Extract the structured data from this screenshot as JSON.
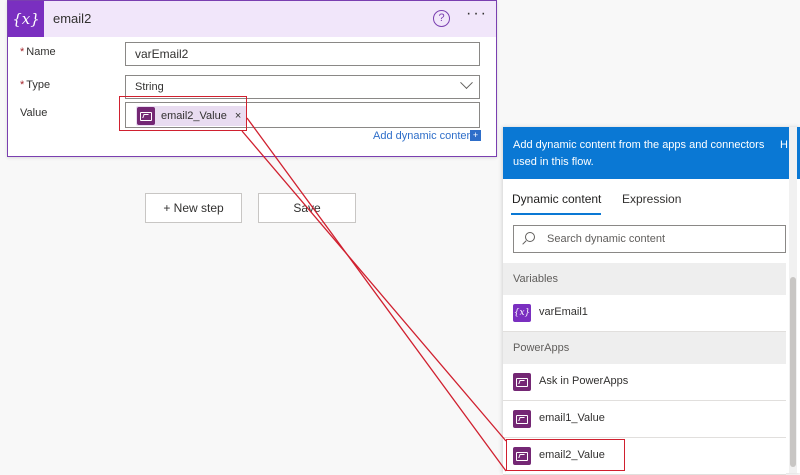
{
  "card": {
    "title": "email2",
    "var_icon": "{x}",
    "help_icon": "?",
    "more_icon": "···",
    "name_label": "Name",
    "name_value": "varEmail2",
    "type_label": "Type",
    "type_value": "String",
    "value_label": "Value",
    "required_mark": "*",
    "token_label": "email2_Value",
    "token_remove": "×",
    "add_dynamic_label": "Add dynamic content",
    "add_dynamic_icon": "+"
  },
  "actions": {
    "new_step": "+ New step",
    "save": "Save"
  },
  "panel": {
    "header_text": "Add dynamic content from the apps and connectors used in this flow.",
    "header_hide": "H",
    "tabs": [
      "Dynamic content",
      "Expression"
    ],
    "search_placeholder": "Search dynamic content",
    "sections": [
      {
        "title": "Variables",
        "items": [
          {
            "label": "varEmail1",
            "icon": "variable-icon"
          }
        ]
      },
      {
        "title": "PowerApps",
        "items": [
          {
            "label": "Ask in PowerApps",
            "icon": "powerapps-icon"
          },
          {
            "label": "email1_Value",
            "icon": "powerapps-icon"
          },
          {
            "label": "email2_Value",
            "icon": "powerapps-icon"
          }
        ]
      }
    ],
    "var_glyph": "{x}"
  },
  "colors": {
    "brand_purple": "#7a2fc0",
    "powerapps": "#742774",
    "accent_blue": "#0a78d4",
    "highlight_red": "#d0202f"
  }
}
